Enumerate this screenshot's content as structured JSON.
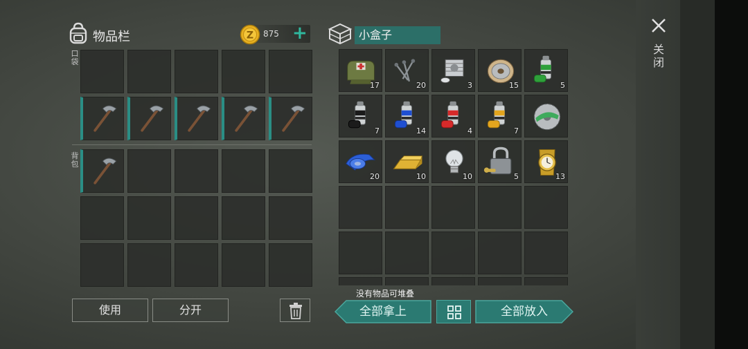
{
  "close": {
    "label": "关闭"
  },
  "inventory": {
    "title": "物品栏",
    "coins": "875",
    "add_label": "+",
    "pocket_label": "口袋",
    "backpack_label": "背包",
    "pocket_rows": [
      [
        null,
        null,
        null,
        null,
        null
      ],
      [
        "pickaxe",
        "pickaxe",
        "pickaxe",
        "pickaxe",
        "pickaxe"
      ]
    ],
    "backpack_rows": [
      [
        "pickaxe",
        null,
        null,
        null,
        null
      ],
      [
        null,
        null,
        null,
        null,
        null
      ],
      [
        null,
        null,
        null,
        null,
        null
      ]
    ],
    "use_label": "使用",
    "split_label": "分开"
  },
  "box": {
    "name": "小盒子",
    "items": [
      {
        "icon": "first-aid-bag",
        "qty": "17"
      },
      {
        "icon": "nails",
        "qty": "20"
      },
      {
        "icon": "engine-part",
        "qty": "3"
      },
      {
        "icon": "wire-spool",
        "qty": "15"
      },
      {
        "icon": "green-paint",
        "qty": "5"
      },
      {
        "icon": "black-paint",
        "qty": "7"
      },
      {
        "icon": "blue-paint",
        "qty": "14"
      },
      {
        "icon": "red-paint",
        "qty": "4"
      },
      {
        "icon": "yellow-paint",
        "qty": "7"
      },
      {
        "icon": "saw-blade",
        "qty": ""
      },
      {
        "icon": "duct-tape",
        "qty": "20"
      },
      {
        "icon": "gold-bar",
        "qty": "10"
      },
      {
        "icon": "light-bulb",
        "qty": "10"
      },
      {
        "icon": "padlock",
        "qty": "5"
      },
      {
        "icon": "gold-watch",
        "qty": "13"
      }
    ],
    "empty_slots": 15,
    "no_stack_text": "没有物品可堆叠",
    "take_all_label": "全部拿上",
    "put_all_label": "全部放入"
  },
  "colors": {
    "accent": "#2c6f68",
    "accent_button": "#2b7a72",
    "coin": "#e7b020",
    "slot_highlight": "#2a8e85"
  }
}
